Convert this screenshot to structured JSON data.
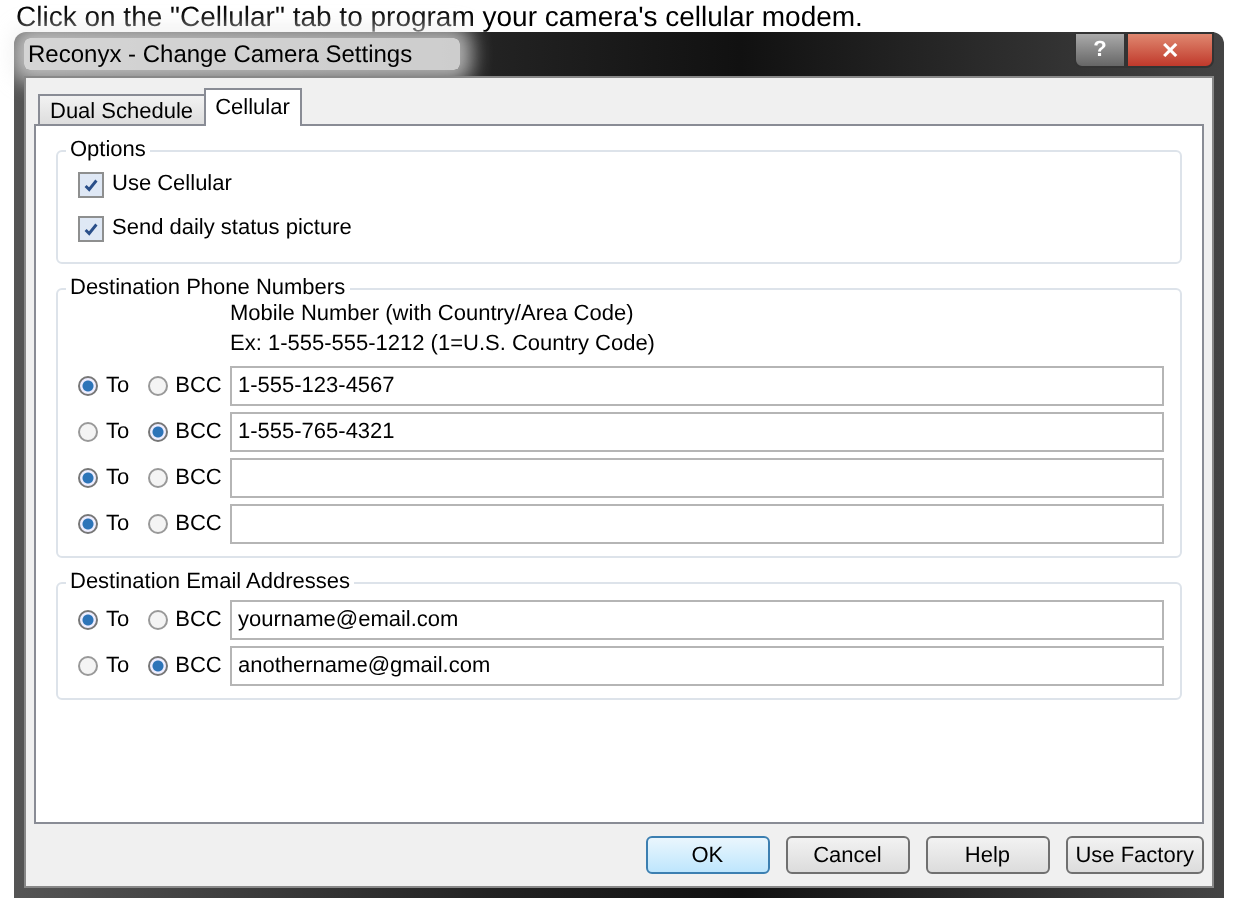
{
  "caption": "Click on the \"Cellular\" tab to program your camera's cellular modem.",
  "window": {
    "title": "Reconyx - Change Camera Settings",
    "controls": [
      {
        "kind": "help",
        "label": "?"
      },
      {
        "kind": "close",
        "label": "✕"
      }
    ]
  },
  "tabs": [
    {
      "label": "Dual Schedule",
      "selected": false
    },
    {
      "label": "Cellular",
      "selected": true
    }
  ],
  "options": {
    "title": "Options",
    "items": [
      {
        "label": "Use Cellular",
        "checked": true
      },
      {
        "label": "Send daily status picture",
        "checked": true
      }
    ]
  },
  "phones": {
    "title": "Destination Phone Numbers",
    "hint": [
      "Mobile Number (with Country/Area Code)",
      "Ex: 1-555-555-1212 (1=U.S. Country Code)"
    ],
    "rows": [
      {
        "options": [
          {
            "label": "To",
            "selected": true
          },
          {
            "label": "BCC",
            "selected": false
          }
        ],
        "value": "1-555-123-4567"
      },
      {
        "options": [
          {
            "label": "To",
            "selected": false
          },
          {
            "label": "BCC",
            "selected": true
          }
        ],
        "value": "1-555-765-4321"
      },
      {
        "options": [
          {
            "label": "To",
            "selected": true
          },
          {
            "label": "BCC",
            "selected": false
          }
        ]
      },
      {
        "options": [
          {
            "label": "To",
            "selected": true
          },
          {
            "label": "BCC",
            "selected": false
          }
        ]
      }
    ]
  },
  "emails": {
    "title": "Destination Email Addresses",
    "rows": [
      {
        "options": [
          {
            "label": "To",
            "selected": true
          },
          {
            "label": "BCC",
            "selected": false
          }
        ],
        "value": "yourname@email.com"
      },
      {
        "options": [
          {
            "label": "To",
            "selected": false
          },
          {
            "label": "BCC",
            "selected": true
          }
        ],
        "value": "anothername@gmail.com"
      }
    ]
  },
  "buttons": [
    {
      "label": "OK",
      "default": true
    },
    {
      "label": "Cancel",
      "default": false
    },
    {
      "label": "Help",
      "default": false
    },
    {
      "label": "Use Factory",
      "default": false
    }
  ]
}
